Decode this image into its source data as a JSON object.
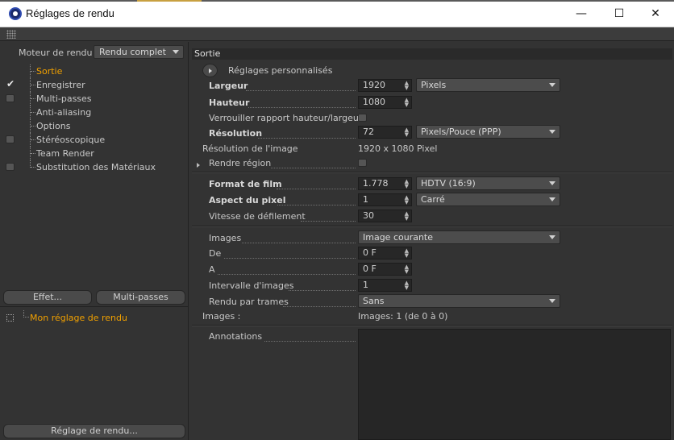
{
  "window": {
    "title": "Réglages de rendu",
    "minimize": "—",
    "maximize": "☐",
    "close": "✕"
  },
  "left": {
    "engine_label": "Moteur de rendu",
    "engine_value": "Rendu complet",
    "items": [
      {
        "label": "Sortie",
        "checked": null,
        "active": true
      },
      {
        "label": "Enregistrer",
        "checked": true,
        "active": false
      },
      {
        "label": "Multi-passes",
        "checked": false,
        "active": false
      },
      {
        "label": "Anti-aliasing",
        "checked": null,
        "active": false
      },
      {
        "label": "Options",
        "checked": null,
        "active": false
      },
      {
        "label": "Stéréoscopique",
        "checked": false,
        "active": false
      },
      {
        "label": "Team Render",
        "checked": null,
        "active": false
      },
      {
        "label": "Substitution des Matériaux",
        "checked": false,
        "active": false
      }
    ],
    "effect_button": "Effet...",
    "multipass_button": "Multi-passes",
    "preset_name": "Mon réglage de rendu",
    "render_setting_button": "Réglage de rendu..."
  },
  "right": {
    "section_title": "Sortie",
    "custom_settings": "Réglages personnalisés",
    "width_label": "Largeur",
    "width_value": "1920",
    "width_unit": "Pixels",
    "height_label": "Hauteur",
    "height_value": "1080",
    "lock_ratio_label": "Verrouiller rapport hauteur/largeur",
    "resolution_label": "Résolution",
    "resolution_value": "72",
    "resolution_unit": "Pixels/Pouce (PPP)",
    "image_res_label": "Résolution de l'image",
    "image_res_value": "1920 x 1080 Pixel",
    "render_region_label": "Rendre région",
    "film_format_label": "Format de film",
    "film_format_value": "1.778",
    "film_format_preset": "HDTV (16:9)",
    "pixel_aspect_label": "Aspect du pixel",
    "pixel_aspect_value": "1",
    "pixel_aspect_preset": "Carré",
    "framerate_label": "Vitesse de défilement",
    "framerate_value": "30",
    "images_label": "Images",
    "images_value": "Image courante",
    "from_label": "De",
    "from_value": "0 F",
    "to_label": "A",
    "to_value": "0 F",
    "interval_label": "Intervalle d'images",
    "interval_value": "1",
    "fields_label": "Rendu par trames",
    "fields_value": "Sans",
    "images_count_label": "Images :",
    "images_count_value": "Images: 1 (de 0 à 0)",
    "annotations_label": "Annotations"
  }
}
